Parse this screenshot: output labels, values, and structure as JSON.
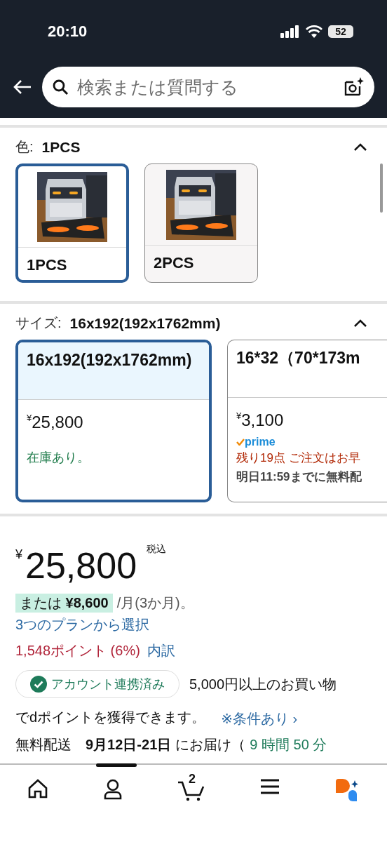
{
  "status_bar": {
    "time": "20:10",
    "battery": "52"
  },
  "search": {
    "placeholder": "検索または質問する"
  },
  "color_section": {
    "label": "色:",
    "value": "1PCS",
    "expanded": true,
    "options": [
      {
        "label": "1PCS",
        "selected": true,
        "kind": "picture"
      },
      {
        "label": "2PCS",
        "selected": false,
        "kind": "picture"
      }
    ]
  },
  "size_section": {
    "label": "サイズ:",
    "value": "16x192(192x1762mm)",
    "expanded": true,
    "options": [
      {
        "kind": "stock",
        "selected": true,
        "title": "16x192(192x1762mm)",
        "currency": "¥",
        "price": "25,800",
        "stock": "在庫あり。"
      },
      {
        "kind": "prime",
        "selected": false,
        "title": "16*32（70*173m",
        "currency": "¥",
        "price": "3,100",
        "badge": "prime",
        "remaining": "残り19点 ご注文はお早",
        "delivery": "明日11:59までに無料配"
      }
    ]
  },
  "price": {
    "currency": "¥",
    "amount": "25,800",
    "tax": "税込"
  },
  "installment": {
    "highlight": "または **¥8,600**",
    "text": "/月(3か月)。",
    "plans_link": "3つのプランから選択"
  },
  "points": {
    "text": "1,548ポイント (6%)",
    "link": "内訳"
  },
  "dpoint": {
    "badge": "アカウント連携済み",
    "lines": [
      "5,000円以上のお買い物",
      "でdポイントを獲得できます。"
    ],
    "link": "※条件あり ›"
  },
  "delivery": {
    "label": "無料配送",
    "date": "9月12日-21日",
    "text": "にお届け（",
    "countdown": "9 時間 50 分"
  },
  "bottom_nav": {
    "cart_count": "2"
  }
}
